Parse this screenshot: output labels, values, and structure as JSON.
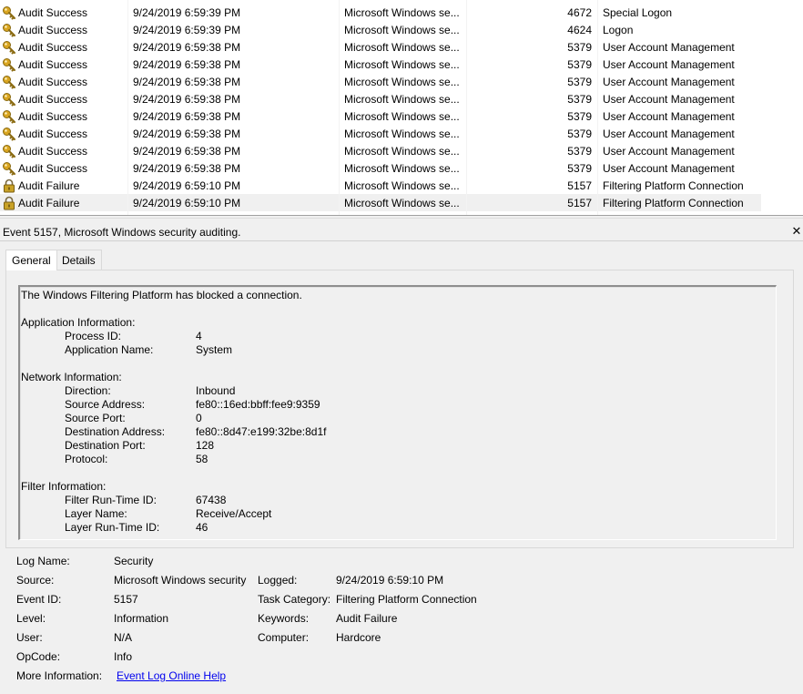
{
  "events": [
    {
      "level": "Audit Success",
      "icon": "key-icon",
      "date": "9/24/2019 6:59:39 PM",
      "source": "Microsoft Windows se...",
      "event_id": "4672",
      "task": "Special Logon"
    },
    {
      "level": "Audit Success",
      "icon": "key-icon",
      "date": "9/24/2019 6:59:39 PM",
      "source": "Microsoft Windows se...",
      "event_id": "4624",
      "task": "Logon"
    },
    {
      "level": "Audit Success",
      "icon": "key-icon",
      "date": "9/24/2019 6:59:38 PM",
      "source": "Microsoft Windows se...",
      "event_id": "5379",
      "task": "User Account Management"
    },
    {
      "level": "Audit Success",
      "icon": "key-icon",
      "date": "9/24/2019 6:59:38 PM",
      "source": "Microsoft Windows se...",
      "event_id": "5379",
      "task": "User Account Management"
    },
    {
      "level": "Audit Success",
      "icon": "key-icon",
      "date": "9/24/2019 6:59:38 PM",
      "source": "Microsoft Windows se...",
      "event_id": "5379",
      "task": "User Account Management"
    },
    {
      "level": "Audit Success",
      "icon": "key-icon",
      "date": "9/24/2019 6:59:38 PM",
      "source": "Microsoft Windows se...",
      "event_id": "5379",
      "task": "User Account Management"
    },
    {
      "level": "Audit Success",
      "icon": "key-icon",
      "date": "9/24/2019 6:59:38 PM",
      "source": "Microsoft Windows se...",
      "event_id": "5379",
      "task": "User Account Management"
    },
    {
      "level": "Audit Success",
      "icon": "key-icon",
      "date": "9/24/2019 6:59:38 PM",
      "source": "Microsoft Windows se...",
      "event_id": "5379",
      "task": "User Account Management"
    },
    {
      "level": "Audit Success",
      "icon": "key-icon",
      "date": "9/24/2019 6:59:38 PM",
      "source": "Microsoft Windows se...",
      "event_id": "5379",
      "task": "User Account Management"
    },
    {
      "level": "Audit Success",
      "icon": "key-icon",
      "date": "9/24/2019 6:59:38 PM",
      "source": "Microsoft Windows se...",
      "event_id": "5379",
      "task": "User Account Management"
    },
    {
      "level": "Audit Failure",
      "icon": "lock-icon",
      "date": "9/24/2019 6:59:10 PM",
      "source": "Microsoft Windows se...",
      "event_id": "5157",
      "task": "Filtering Platform Connection"
    },
    {
      "level": "Audit Failure",
      "icon": "lock-icon",
      "date": "9/24/2019 6:59:10 PM",
      "source": "Microsoft Windows se...",
      "event_id": "5157",
      "task": "Filtering Platform Connection"
    }
  ],
  "detail": {
    "title": "Event 5157, Microsoft Windows security auditing.",
    "close": "✕",
    "tabs": {
      "general": "General",
      "details": "Details"
    },
    "description": {
      "intro": "The Windows Filtering Platform has blocked a connection.",
      "app_header": "Application Information:",
      "process_id_label": "Process ID:",
      "process_id": "4",
      "app_name_label": "Application Name:",
      "app_name": "System",
      "net_header": "Network Information:",
      "direction_label": "Direction:",
      "direction": "Inbound",
      "src_addr_label": "Source Address:",
      "src_addr": "fe80::16ed:bbff:fee9:9359",
      "src_port_label": "Source Port:",
      "src_port": "0",
      "dst_addr_label": "Destination Address:",
      "dst_addr": "fe80::8d47:e199:32be:8d1f",
      "dst_port_label": "Destination Port:",
      "dst_port": "128",
      "protocol_label": "Protocol:",
      "protocol": "58",
      "filter_header": "Filter Information:",
      "filter_id_label": "Filter Run-Time ID:",
      "filter_id": "67438",
      "layer_name_label": "Layer Name:",
      "layer_name": "Receive/Accept",
      "layer_id_label": "Layer Run-Time ID:",
      "layer_id": "46"
    },
    "fields": {
      "log_name_label": "Log Name:",
      "log_name": "Security",
      "source_label": "Source:",
      "source": "Microsoft Windows security",
      "logged_label": "Logged:",
      "logged": "9/24/2019 6:59:10 PM",
      "event_id_label": "Event ID:",
      "event_id": "5157",
      "task_label": "Task Category:",
      "task": "Filtering Platform Connection",
      "level_label": "Level:",
      "level": "Information",
      "keywords_label": "Keywords:",
      "keywords": "Audit Failure",
      "user_label": "User:",
      "user": "N/A",
      "computer_label": "Computer:",
      "computer": "Hardcore",
      "opcode_label": "OpCode:",
      "opcode": "Info",
      "more_info_label": "More Information:",
      "more_info_link": "Event Log Online Help"
    }
  },
  "colors": {
    "key_gold": "#d9a521",
    "lock_gold": "#c9a227",
    "link": "#0000ee"
  }
}
